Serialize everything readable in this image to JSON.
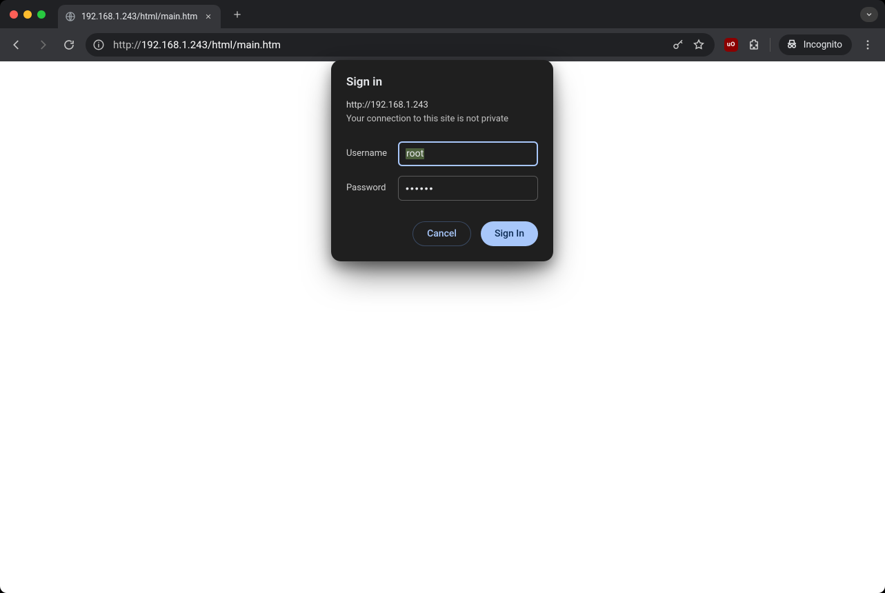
{
  "tab": {
    "title": "192.168.1.243/html/main.htm"
  },
  "toolbar": {
    "url_scheme": "http://",
    "url_rest": "192.168.1.243/html/main.htm",
    "incognito_label": "Incognito",
    "ublock_badge": "uO"
  },
  "dialog": {
    "title": "Sign in",
    "origin": "http://192.168.1.243",
    "warning": "Your connection to this site is not private",
    "username_label": "Username",
    "password_label": "Password",
    "username_value": "root",
    "password_masked": "••••••",
    "cancel_label": "Cancel",
    "signin_label": "Sign In"
  }
}
